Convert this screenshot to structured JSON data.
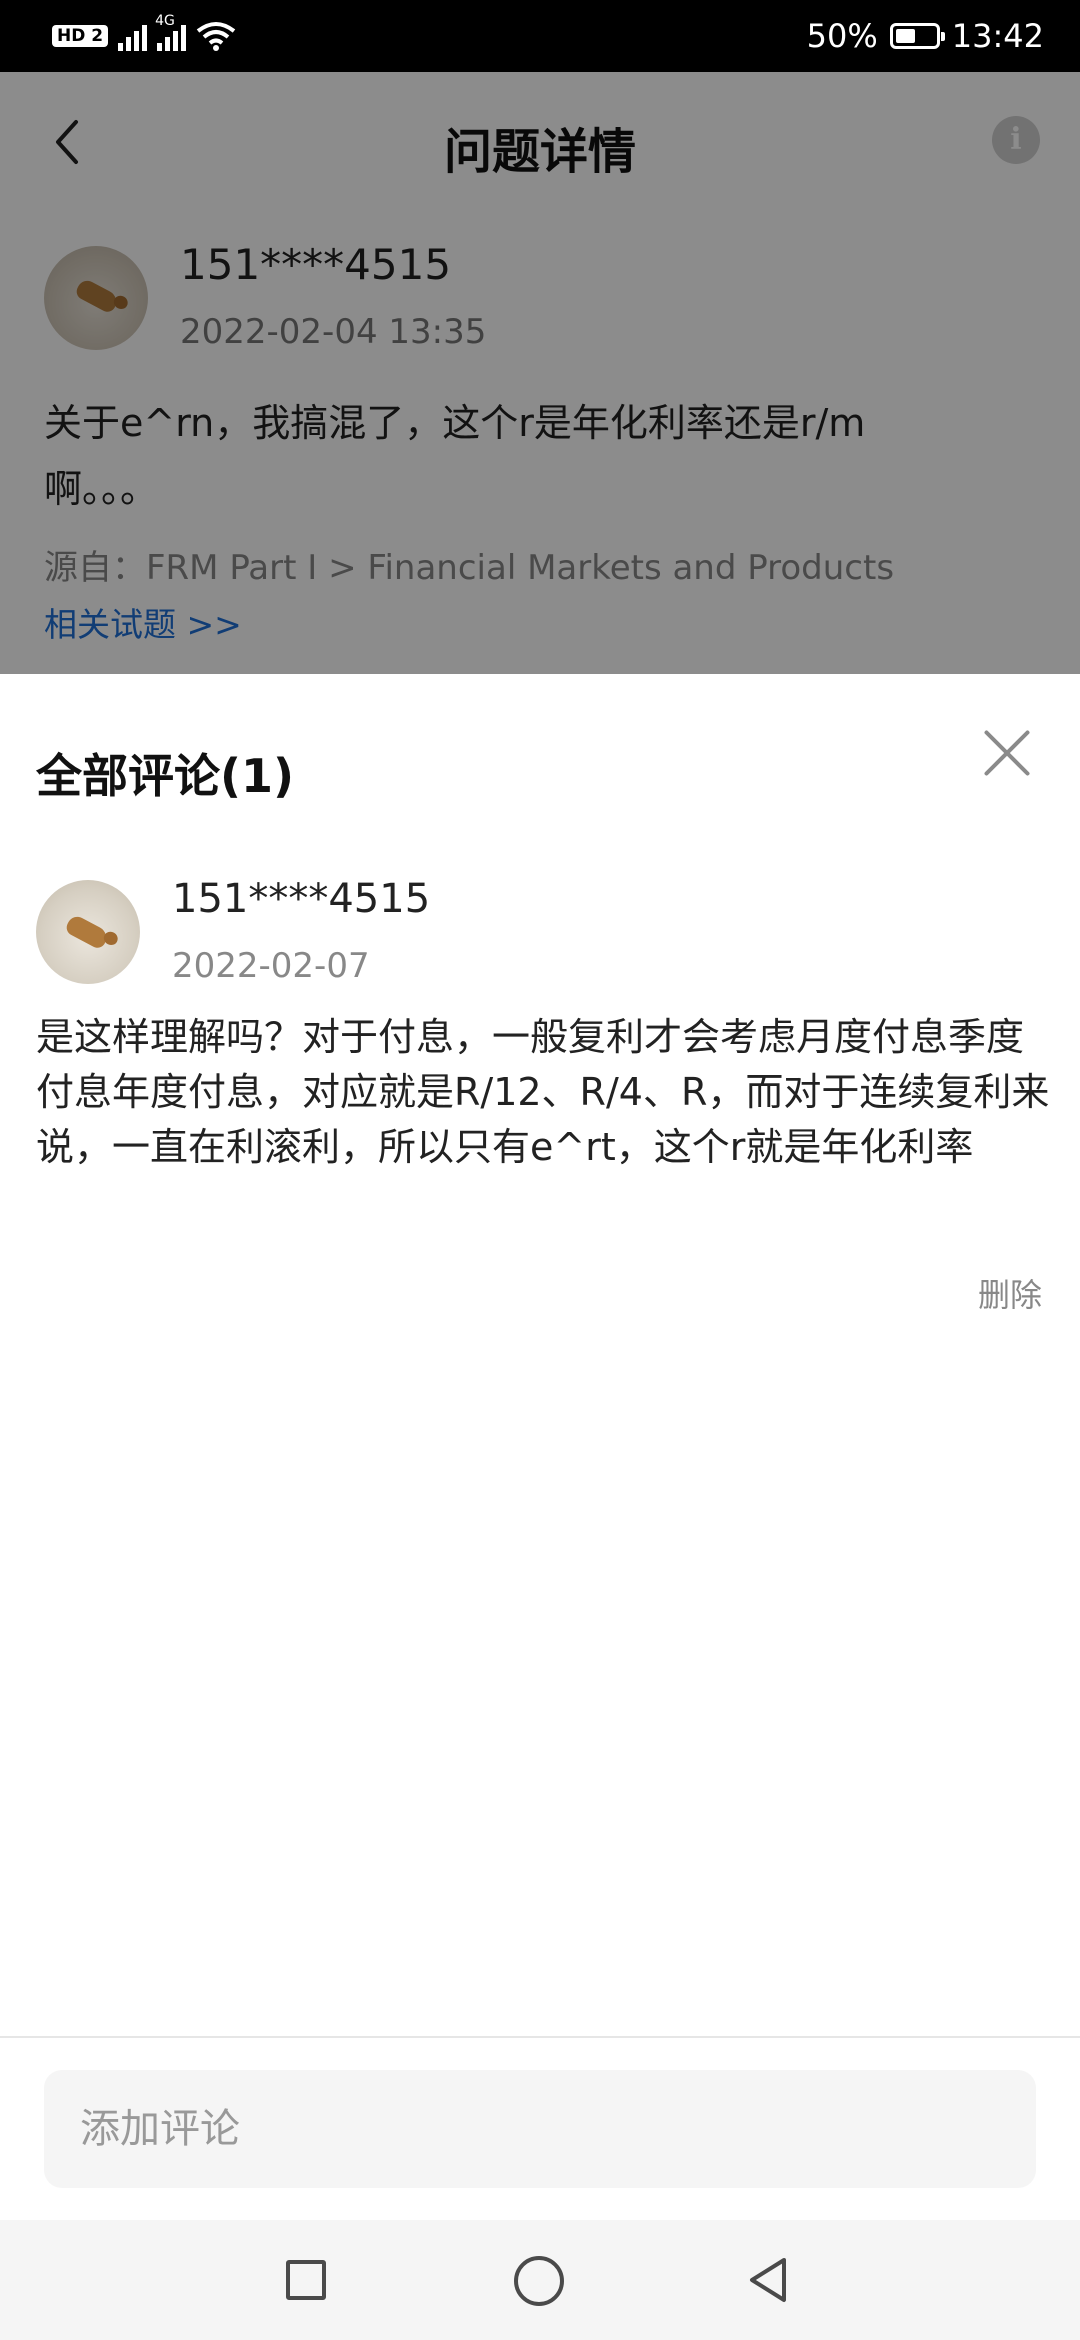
{
  "status_bar": {
    "hd_label": "HD 2",
    "network_label": "4G",
    "battery_percent": "50%",
    "battery_level": 0.5,
    "time": "13:42"
  },
  "header": {
    "title": "问题详情",
    "info_icon": "i"
  },
  "question": {
    "username": "151****4515",
    "datetime": "2022-02-04 13:35",
    "text": "关于e^rn，我搞混了，这个r是年化利率还是r/m啊。。。",
    "source": "源自：FRM Part I > Financial Markets and Products",
    "related_link": "相关试题 >>"
  },
  "comments_sheet": {
    "title": "全部评论(1)",
    "comments": [
      {
        "username": "151****4515",
        "date": "2022-02-07",
        "text": "是这样理解吗？对于付息，一般复利才会考虑月度付息季度付息年度付息，对应就是R/12、R/4、R，而对于连续复利来说，一直在利滚利，所以只有e^rt，这个r就是年化利率",
        "delete_label": "删除"
      }
    ]
  },
  "comment_input": {
    "placeholder": "添加评论",
    "value": ""
  },
  "icons": {
    "back": "chevron-left-icon",
    "info": "info-icon",
    "close": "close-icon",
    "nav_recents": "square-icon",
    "nav_home": "circle-icon",
    "nav_back": "triangle-back-icon"
  },
  "colors": {
    "link": "#1f6fd6",
    "overlay": "rgba(0,0,0,0.45)"
  }
}
